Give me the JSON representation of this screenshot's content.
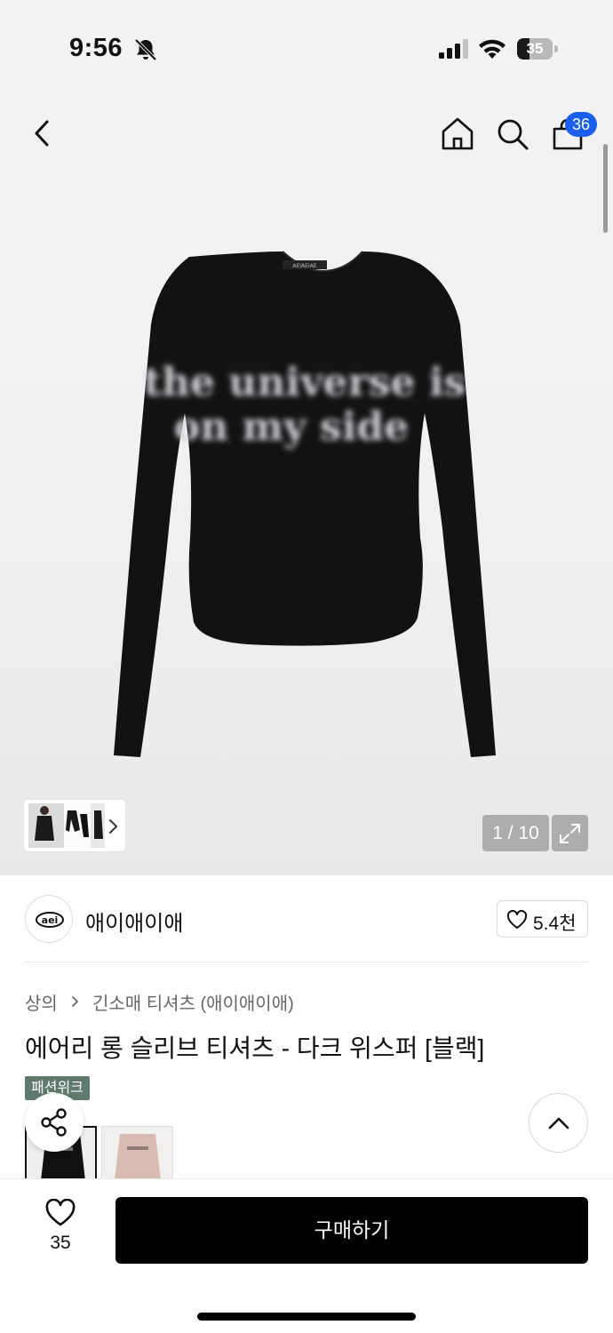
{
  "status_bar": {
    "time": "9:56",
    "battery_level": "35",
    "battery_percent": 35,
    "icons": [
      "bell-off-icon",
      "cellular-signal-icon",
      "wifi-icon",
      "battery-icon"
    ]
  },
  "header": {
    "icons": [
      "back-icon",
      "home-icon",
      "search-icon",
      "shopping-bag-icon"
    ],
    "cart_badge": "36"
  },
  "gallery": {
    "pager": "1 / 10",
    "current_image": 1,
    "total_images": 10,
    "shirt_print_line1": "the universe is",
    "shirt_print_line2": "on my side",
    "shirt_label": "AEIAEIAE",
    "icons": [
      "thumbnail-next-chevron-icon",
      "expand-icon"
    ]
  },
  "brand": {
    "logo_text": "aei",
    "name": "애이애이애",
    "like_count": "5.4천"
  },
  "product": {
    "breadcrumb": [
      "상의",
      "긴소매 티셔츠 (애이애이애)"
    ],
    "title": "에어리 롱 슬리브 티셔츠 - 다크 위스퍼 [블랙]",
    "event_badge": "패션위크",
    "colors": [
      "black",
      "pink"
    ]
  },
  "bottom_bar": {
    "wish_count": "35",
    "buy_label": "구매하기"
  },
  "colors": {
    "badge_blue": "#1a5ff0",
    "event_badge_green": "#5f7a6c",
    "buy_button": "#000000"
  }
}
